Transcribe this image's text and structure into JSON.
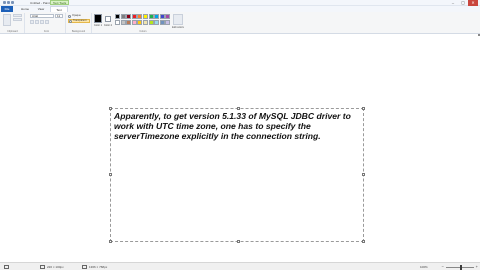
{
  "titlebar": {
    "title": "Untitled - Paint",
    "context_tab": "Text Tools",
    "min": "–",
    "max": "▢",
    "close": "✕"
  },
  "tabs": {
    "file": "File",
    "items": [
      "Home",
      "View",
      "Text"
    ],
    "active_index": 2
  },
  "ribbon": {
    "clipboard_label": "Clipboard",
    "font_label": "Font",
    "background_label": "Background",
    "colors_label": "Colors",
    "font_name": "Arial",
    "font_size": "11",
    "bg_opaque": "Opaque",
    "bg_transparent": "Transparent",
    "color1": "Color 1",
    "color2": "Color 2",
    "edit_colors": "Edit colors"
  },
  "palette": [
    "#000000",
    "#7f7f7f",
    "#880015",
    "#ed1c24",
    "#ff7f27",
    "#fff200",
    "#22b14c",
    "#00a2e8",
    "#3f48cc",
    "#a349a4",
    "#ffffff",
    "#c3c3c3",
    "#b97a57",
    "#ffaec9",
    "#ffc90e",
    "#efe4b0",
    "#b5e61d",
    "#99d9ea",
    "#7092be",
    "#c8bfe7"
  ],
  "canvas": {
    "text": "Apparently, to get version 5.1.33 of MySQL JDBC driver to work with UTC time zone, one has to specify the serverTimezone explicitly in the connection string."
  },
  "status": {
    "cursor": "",
    "selection": "220 × 100px",
    "size": "1366 × 768px",
    "zoom": "100%"
  }
}
